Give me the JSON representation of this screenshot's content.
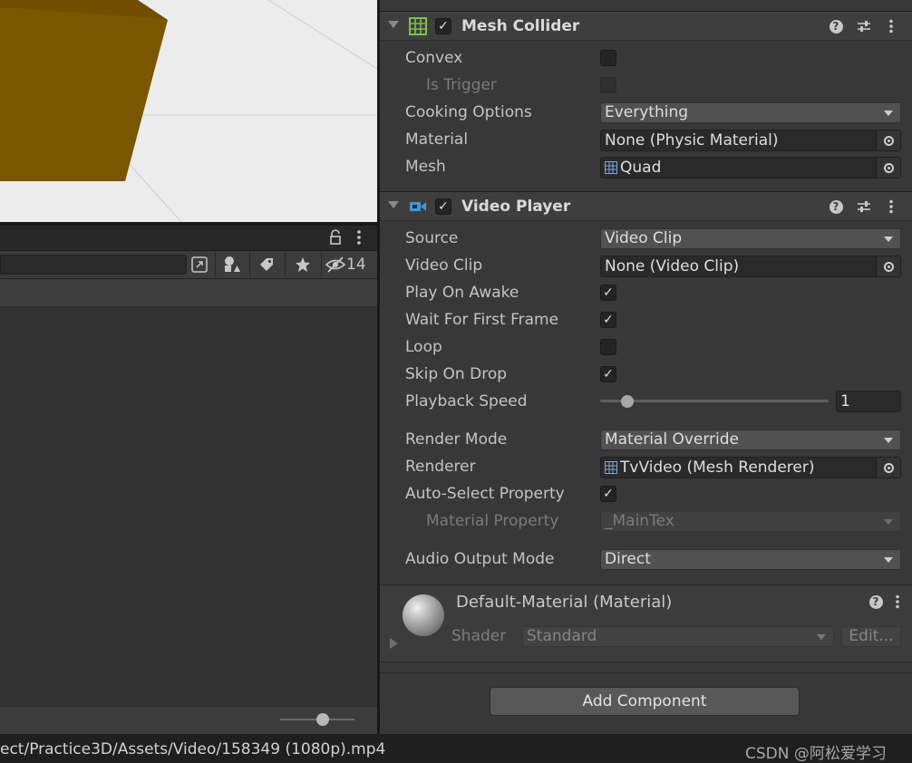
{
  "project_panel": {
    "hidden_count": "14"
  },
  "status": {
    "path": "ect/Practice3D/Assets/Video/158349 (1080p).mp4",
    "watermark": "CSDN @阿松爱学习"
  },
  "mesh_collider": {
    "title": "Mesh Collider",
    "enabled": true,
    "props": {
      "convex_label": "Convex",
      "is_trigger_label": "Is Trigger",
      "cooking_label": "Cooking Options",
      "cooking_value": "Everything",
      "material_label": "Material",
      "material_value": "None (Physic Material)",
      "mesh_label": "Mesh",
      "mesh_value": "Quad"
    }
  },
  "video_player": {
    "title": "Video Player",
    "enabled": true,
    "props": {
      "source_label": "Source",
      "source_value": "Video Clip",
      "clip_label": "Video Clip",
      "clip_value": "None (Video Clip)",
      "play_on_awake_label": "Play On Awake",
      "play_on_awake": true,
      "wait_label": "Wait For First Frame",
      "wait": true,
      "loop_label": "Loop",
      "loop": false,
      "skip_label": "Skip On Drop",
      "skip": true,
      "speed_label": "Playback Speed",
      "speed_value": "1",
      "render_mode_label": "Render Mode",
      "render_mode_value": "Material Override",
      "renderer_label": "Renderer",
      "renderer_value": "TvVideo (Mesh Renderer)",
      "auto_select_label": "Auto-Select Property",
      "auto_select": true,
      "mat_prop_label": "Material Property",
      "mat_prop_value": "_MainTex",
      "audio_label": "Audio Output Mode",
      "audio_value": "Direct"
    }
  },
  "material": {
    "title": "Default-Material (Material)",
    "shader_label": "Shader",
    "shader_value": "Standard",
    "edit_label": "Edit..."
  },
  "add_component_label": "Add Component",
  "colors": {
    "cube": "#7a5600",
    "mesh_icon": "#7ec14a",
    "video_icon": "#3b9ad9"
  }
}
